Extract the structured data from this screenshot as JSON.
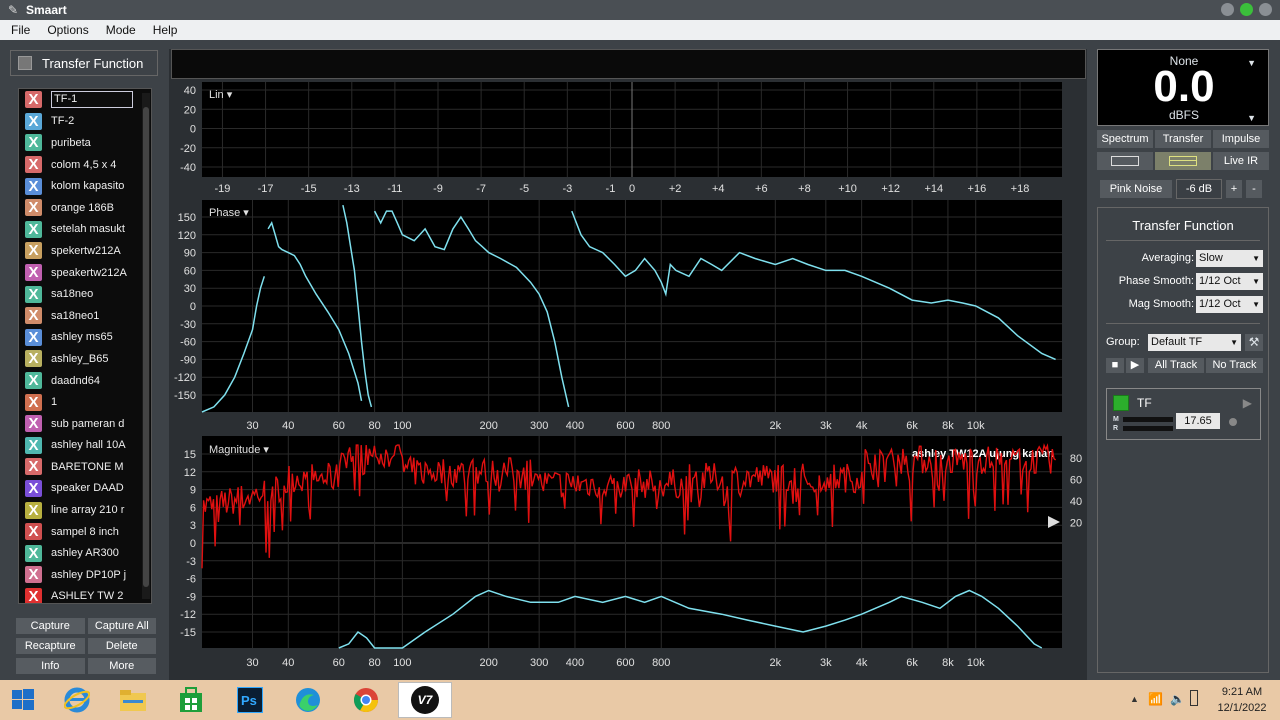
{
  "window": {
    "title": "Smaart"
  },
  "menu": [
    "File",
    "Options",
    "Mode",
    "Help"
  ],
  "left_panel": {
    "header": "Transfer Function",
    "items": [
      {
        "label": "TF-1",
        "color": "#d76a6a",
        "selected": true
      },
      {
        "label": "TF-2",
        "color": "#5aa8d8"
      },
      {
        "label": "puribeta",
        "color": "#4fb89a"
      },
      {
        "label": "colom 4,5 x 4",
        "color": "#d76a6a"
      },
      {
        "label": "kolom kapasito",
        "color": "#5a8ed8"
      },
      {
        "label": "orange 186B",
        "color": "#d08c6a"
      },
      {
        "label": "setelah masukt",
        "color": "#4fb89a"
      },
      {
        "label": "spekertw212A",
        "color": "#c8a060"
      },
      {
        "label": "speakertw212A",
        "color": "#c060b0"
      },
      {
        "label": "sa18neo",
        "color": "#4fb89a"
      },
      {
        "label": "sa18neo1",
        "color": "#d08c6a"
      },
      {
        "label": "ashley ms65",
        "color": "#5a8ed8"
      },
      {
        "label": "ashley_B65",
        "color": "#b8b060"
      },
      {
        "label": "daadnd64",
        "color": "#4fb89a"
      },
      {
        "label": "1",
        "color": "#d07050"
      },
      {
        "label": "sub pameran d",
        "color": "#c060b0"
      },
      {
        "label": "ashley hall 10A",
        "color": "#4fb8b0"
      },
      {
        "label": "BARETONE M",
        "color": "#d76a6a"
      },
      {
        "label": "speaker DAAD",
        "color": "#7a4fd8"
      },
      {
        "label": "line array 210 r",
        "color": "#b8b040"
      },
      {
        "label": "sampel 8 inch",
        "color": "#d05050"
      },
      {
        "label": "ashley AR300",
        "color": "#4fb89a"
      },
      {
        "label": "ashley DP10P j",
        "color": "#d07090"
      },
      {
        "label": "ASHLEY TW 2",
        "color": "#e03030"
      }
    ],
    "buttons": [
      "Capture",
      "Capture All",
      "Recapture",
      "Delete",
      "Info",
      "More"
    ]
  },
  "plots": {
    "live_ir": {
      "title": "Lin",
      "y_ticks": [
        "40",
        "20",
        "0",
        "-20",
        "-40"
      ],
      "x_ticks": [
        "-19",
        "-17",
        "-15",
        "-13",
        "-11",
        "-9",
        "-7",
        "-5",
        "-3",
        "-1",
        "0",
        "+2",
        "+4",
        "+6",
        "+8",
        "+10",
        "+12",
        "+14",
        "+16",
        "+18"
      ]
    },
    "phase": {
      "title": "Phase",
      "y_ticks": [
        "150",
        "120",
        "90",
        "60",
        "30",
        "0",
        "-30",
        "-60",
        "-90",
        "-120",
        "-150"
      ],
      "x_ticks": [
        "30",
        "40",
        "60",
        "80",
        "100",
        "200",
        "300",
        "400",
        "600",
        "800",
        "2k",
        "3k",
        "4k",
        "6k",
        "8k",
        "10k"
      ],
      "trace_color": "#7fe0ee"
    },
    "magnitude": {
      "title": "Magnitude",
      "y_ticks": [
        "15",
        "12",
        "9",
        "6",
        "3",
        "0",
        "-3",
        "-6",
        "-9",
        "-12",
        "-15"
      ],
      "right_ticks": [
        "80",
        "60",
        "40",
        "20"
      ],
      "x_ticks": [
        "30",
        "40",
        "60",
        "80",
        "100",
        "200",
        "300",
        "400",
        "600",
        "800",
        "2k",
        "3k",
        "4k",
        "6k",
        "8k",
        "10k"
      ],
      "trace_label": "ashley TW12A ujung kanan",
      "trace_color": "#e01010",
      "coherence_color": "#7fe0ee"
    }
  },
  "meter": {
    "source": "None",
    "value": "0.0",
    "unit": "dBFS"
  },
  "right_tabs": [
    "Spectrum",
    "Transfer",
    "Impulse"
  ],
  "right_modes": [
    "",
    "",
    "Live IR"
  ],
  "generator": {
    "label": "Pink Noise",
    "level": "-6 dB",
    "plus": "+",
    "minus": "-"
  },
  "tf_settings": {
    "header": "Transfer Function",
    "averaging_label": "Averaging:",
    "averaging": "Slow",
    "phase_smooth_label": "Phase Smooth:",
    "phase_smooth": "1/12 Oct",
    "mag_smooth_label": "Mag Smooth:",
    "mag_smooth": "1/12 Oct",
    "group_label": "Group:",
    "group": "Default TF",
    "all_track": "All Track",
    "no_track": "No Track",
    "channel": {
      "name": "TF",
      "m": "M",
      "r": "R",
      "delay": "17.65"
    }
  },
  "taskbar": {
    "time": "9:21 AM",
    "date": "12/1/2022",
    "apps": [
      "Windows Start",
      "Internet Explorer",
      "File Explorer",
      "Store",
      "Photoshop",
      "Edge",
      "Chrome",
      "Smaart V7"
    ],
    "smaart_glyph": "V7"
  }
}
